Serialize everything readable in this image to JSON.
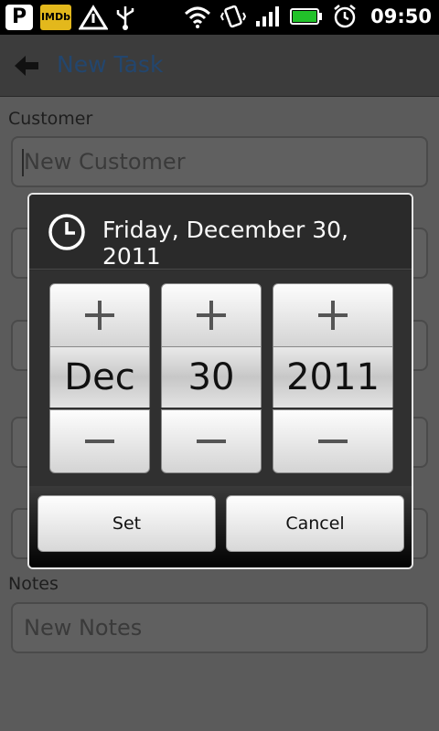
{
  "status_bar": {
    "app_badge_p": "P",
    "app_badge_imdb": "IMDb",
    "time": "09:50",
    "icons": [
      "p-app-icon",
      "imdb-icon",
      "warning-icon",
      "usb-icon",
      "wifi-icon",
      "vibrate-icon",
      "signal-icon",
      "battery-icon",
      "alarm-icon"
    ],
    "battery_color": "#22c22a"
  },
  "action_bar": {
    "title": "New Task",
    "title_color": "#23466e"
  },
  "form": {
    "customer_label": "Customer",
    "customer_placeholder": "New Customer",
    "notes_label": "Notes",
    "notes_placeholder": "New Notes"
  },
  "dialog": {
    "title": "Friday, December 30, 2011",
    "month": "Dec",
    "day": "30",
    "year": "2011",
    "set_label": "Set",
    "cancel_label": "Cancel"
  }
}
